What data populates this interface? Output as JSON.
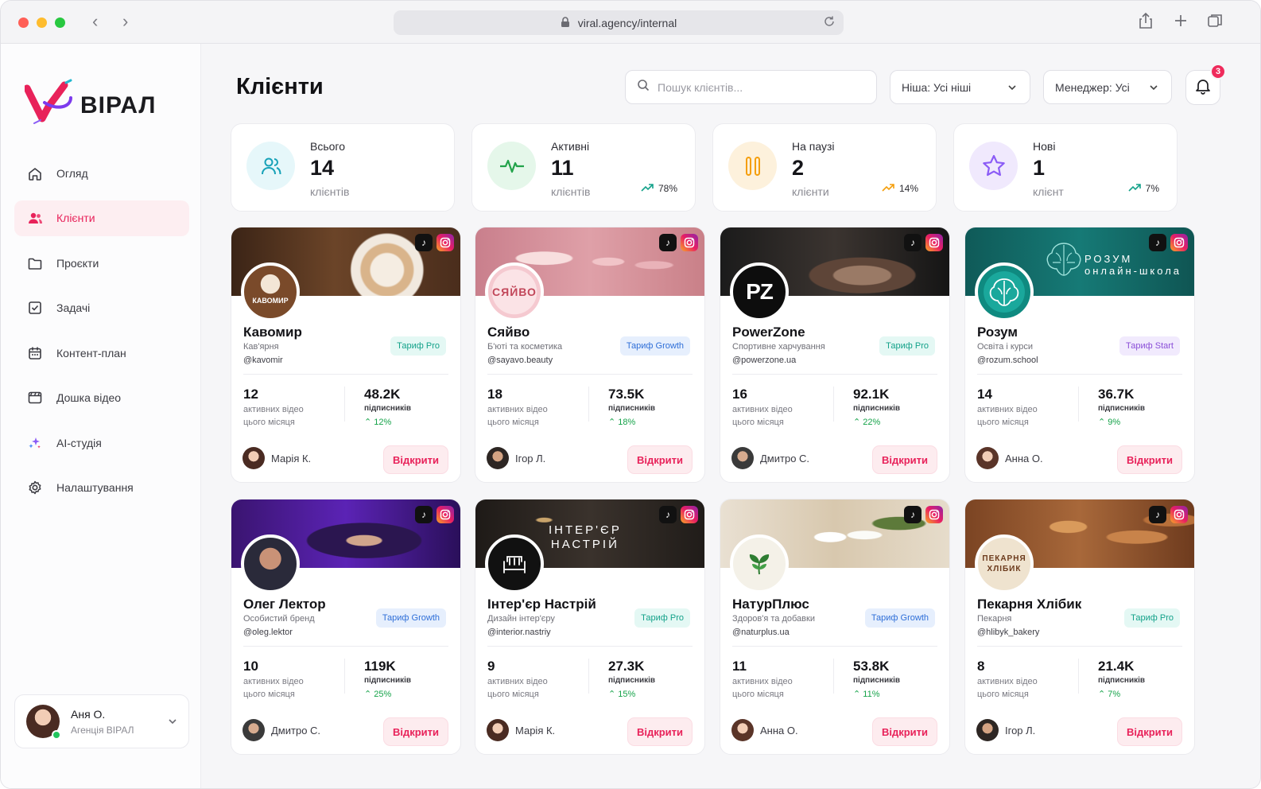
{
  "browser": {
    "url": "viral.agency/internal"
  },
  "brand": {
    "name": "ВІРАЛ",
    "accent": "#e8225a"
  },
  "sidebar": {
    "items": [
      {
        "label": "Огляд",
        "icon": "home-icon"
      },
      {
        "label": "Клієнти",
        "icon": "users-icon",
        "active": true
      },
      {
        "label": "Проєкти",
        "icon": "folder-icon"
      },
      {
        "label": "Задачі",
        "icon": "checkbox-icon"
      },
      {
        "label": "Контент-план",
        "icon": "calendar-icon"
      },
      {
        "label": "Дошка відео",
        "icon": "video-board-icon"
      },
      {
        "label": "AI-студія",
        "icon": "sparkles-icon"
      },
      {
        "label": "Налаштування",
        "icon": "gear-icon"
      }
    ],
    "user": {
      "name": "Аня О.",
      "org": "Агенція ВІРАЛ"
    }
  },
  "header": {
    "title": "Клієнти",
    "search_placeholder": "Пошук клієнтів...",
    "niche_filter": "Ніша: Усі ніші",
    "manager_filter": "Менеджер: Усі",
    "notifications": "3"
  },
  "stats": [
    {
      "label": "Всього",
      "value": "14",
      "sub": "клієнтів",
      "trend": "",
      "color": "#e6f7fa",
      "icon": "users-icon"
    },
    {
      "label": "Активні",
      "value": "11",
      "sub": "клієнтів",
      "trend": "78%",
      "color": "#e5f7ea",
      "icon": "pulse-icon"
    },
    {
      "label": "На паузі",
      "value": "2",
      "sub": "клієнти",
      "trend": "14%",
      "color": "#fdf1dc",
      "icon": "pause-icon"
    },
    {
      "label": "Нові",
      "value": "1",
      "sub": "клієнт",
      "trend": "7%",
      "color": "#f0e9fd",
      "icon": "star-icon"
    }
  ],
  "metric_labels": {
    "videos": "активних відео",
    "videos_2": "цього місяця",
    "subs": "підписників",
    "open": "Відкрити",
    "tiktok": "♪"
  },
  "clients": [
    {
      "name": "Кавомир",
      "category": "Кав'ярня",
      "handle": "@kavomir",
      "plan": "Тариф Pro",
      "plan_type": "pro",
      "videos": "12",
      "subscribers": "48.2K",
      "growth": "12%",
      "manager": "Марія К.",
      "avatar_text": "КАВОМИР",
      "cover_text": ""
    },
    {
      "name": "Сяйво",
      "category": "Б'юті та косметика",
      "handle": "@sayavo.beauty",
      "plan": "Тариф Growth",
      "plan_type": "growth",
      "videos": "18",
      "subscribers": "73.5K",
      "growth": "18%",
      "manager": "Ігор Л.",
      "avatar_text": "СЯЙВО",
      "cover_text": ""
    },
    {
      "name": "PowerZone",
      "category": "Спортивне харчування",
      "handle": "@powerzone.ua",
      "plan": "Тариф Pro",
      "plan_type": "pro",
      "videos": "16",
      "subscribers": "92.1K",
      "growth": "22%",
      "manager": "Дмитро С.",
      "avatar_text": "PZ",
      "cover_text": ""
    },
    {
      "name": "Розум",
      "category": "Освіта і курси",
      "handle": "@rozum.school",
      "plan": "Тариф Start",
      "plan_type": "start",
      "videos": "14",
      "subscribers": "36.7K",
      "growth": "9%",
      "manager": "Анна О.",
      "avatar_text": "",
      "cover_text": "РОЗУМ\nонлайн-школа"
    },
    {
      "name": "Олег Лектор",
      "category": "Особистий бренд",
      "handle": "@oleg.lektor",
      "plan": "Тариф Growth",
      "plan_type": "growth",
      "videos": "10",
      "subscribers": "119K",
      "growth": "25%",
      "manager": "Дмитро С.",
      "avatar_text": "",
      "cover_text": ""
    },
    {
      "name": "Інтер'єр Настрій",
      "category": "Дизайн інтер'єру",
      "handle": "@interior.nastriy",
      "plan": "Тариф Pro",
      "plan_type": "pro",
      "videos": "9",
      "subscribers": "27.3K",
      "growth": "15%",
      "manager": "Марія К.",
      "avatar_text": "",
      "cover_text": "ІНТЕР'ЄР\nНАСТРІЙ"
    },
    {
      "name": "НатурПлюс",
      "category": "Здоров'я та добавки",
      "handle": "@naturplus.ua",
      "plan": "Тариф Growth",
      "plan_type": "growth",
      "videos": "11",
      "subscribers": "53.8K",
      "growth": "11%",
      "manager": "Анна О.",
      "avatar_text": "",
      "cover_text": ""
    },
    {
      "name": "Пекарня Хлібик",
      "category": "Пекарня",
      "handle": "@hlibyk_bakery",
      "plan": "Тариф Pro",
      "plan_type": "pro",
      "videos": "8",
      "subscribers": "21.4K",
      "growth": "7%",
      "manager": "Ігор Л.",
      "avatar_text": "ПЕКАРНЯ ХЛІБИК",
      "cover_text": ""
    }
  ]
}
